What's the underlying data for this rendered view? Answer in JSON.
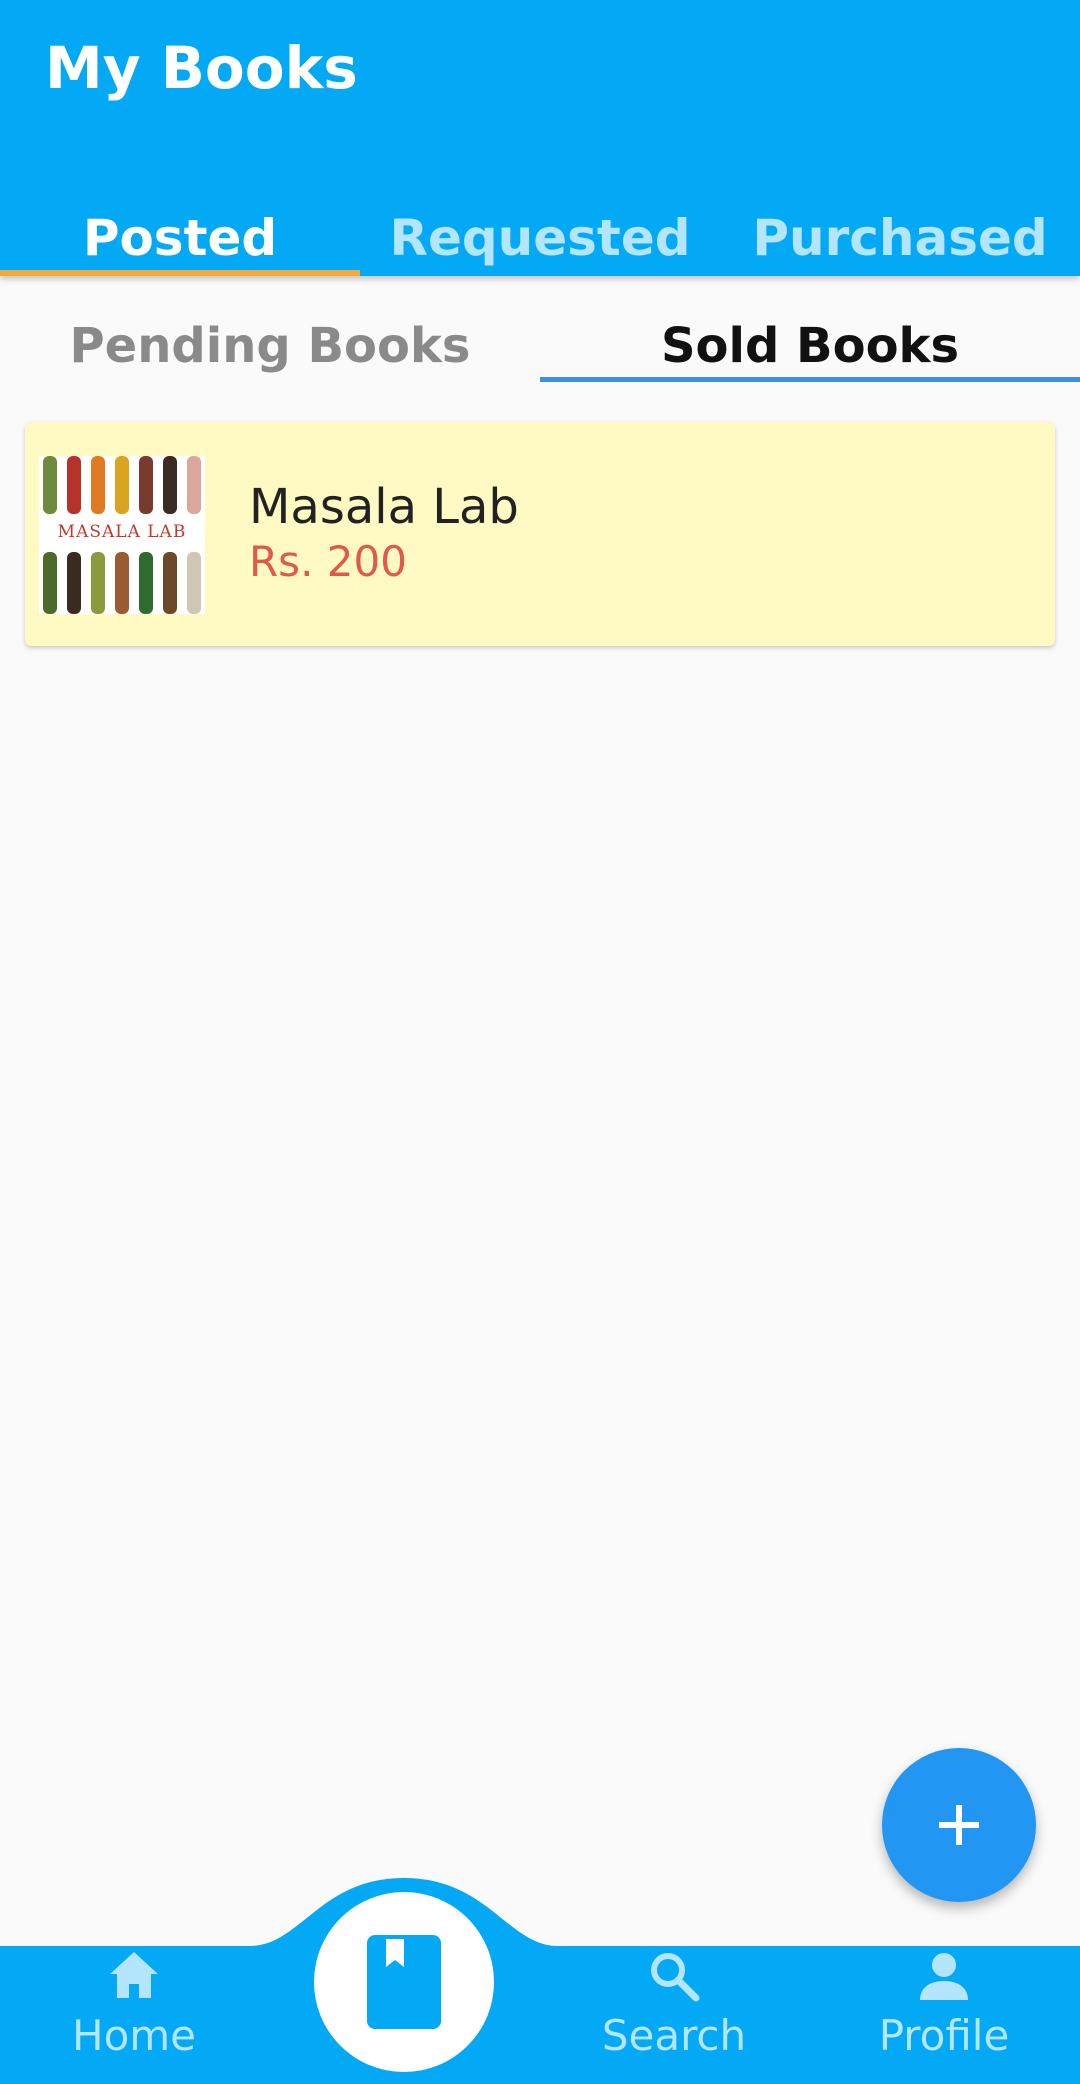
{
  "app_bar": {
    "title": "My Books",
    "color": "#03a9f4"
  },
  "top_tabs": {
    "items": [
      {
        "label": "Posted",
        "selected": true
      },
      {
        "label": "Requested",
        "selected": false
      },
      {
        "label": "Purchased",
        "selected": false
      }
    ],
    "indicator_color": "#f4a83d"
  },
  "sub_tabs": {
    "items": [
      {
        "label": "Pending Books",
        "selected": false
      },
      {
        "label": "Sold Books",
        "selected": true
      }
    ],
    "indicator_color": "#3d8fe8"
  },
  "books": [
    {
      "title": "Masala Lab",
      "price": "Rs. 200",
      "cover_icon": "book-cover-image",
      "cover_text": "MASALA LAB",
      "card_color": "#fff9c4",
      "price_color": "#e05a4a"
    }
  ],
  "fab": {
    "icon": "plus-icon",
    "color": "#2196f3"
  },
  "bottom_nav": {
    "items": [
      {
        "label": "Home",
        "icon": "home-icon"
      },
      {
        "label": "",
        "icon": "book-bookmark-icon",
        "selected": true
      },
      {
        "label": "Search",
        "icon": "search-icon"
      },
      {
        "label": "Profile",
        "icon": "person-icon"
      }
    ],
    "color": "#03a9f4"
  }
}
